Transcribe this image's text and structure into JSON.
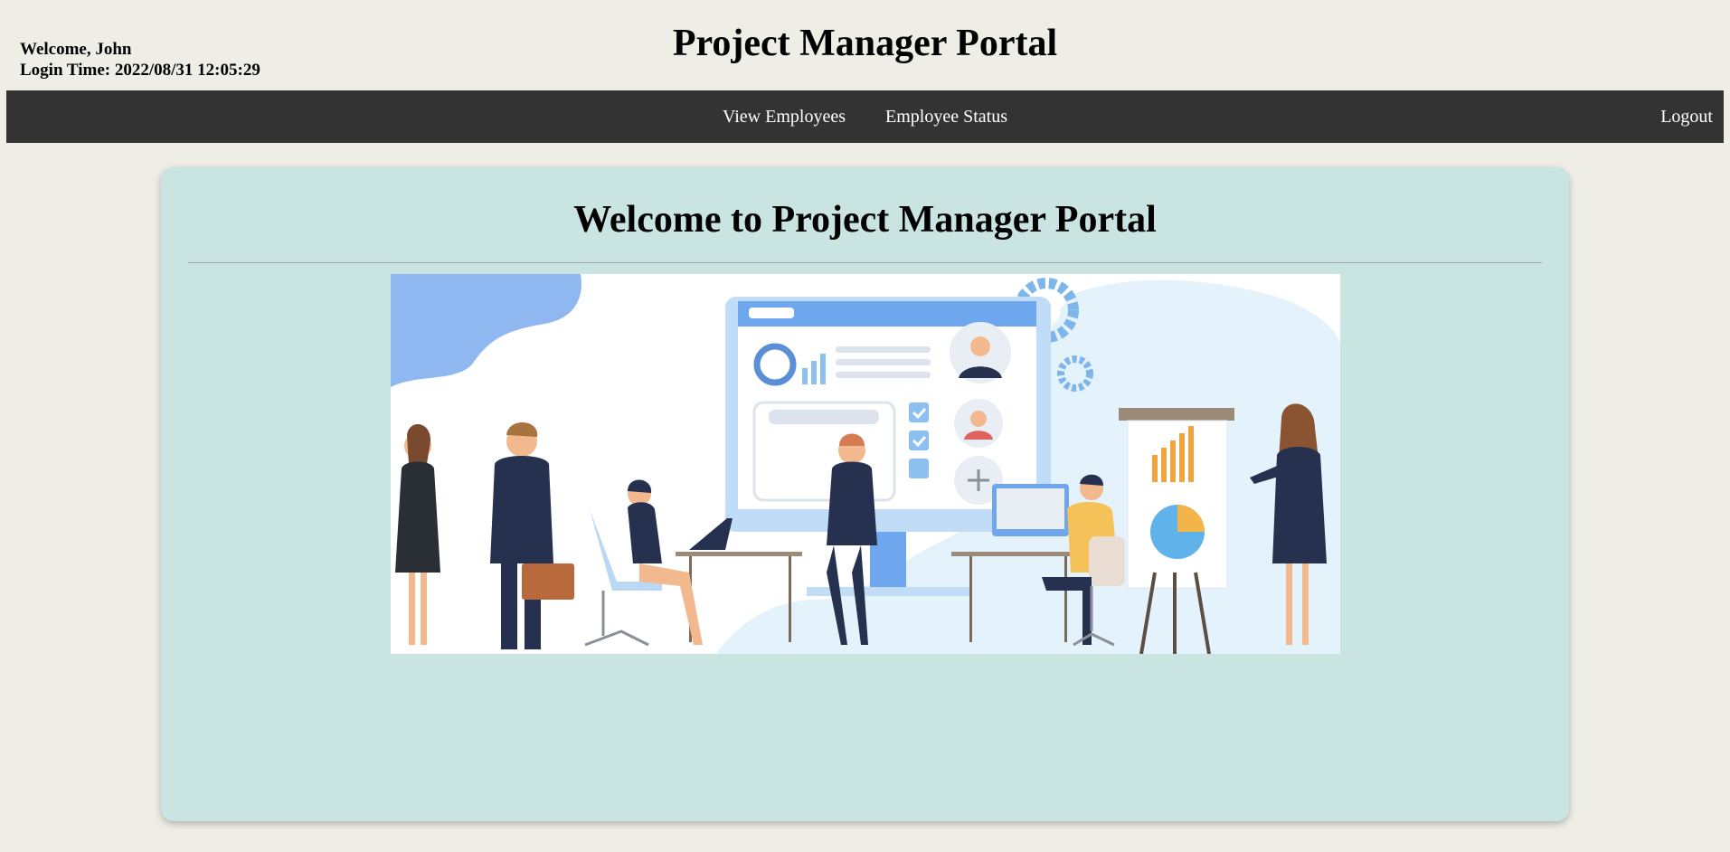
{
  "header": {
    "welcome": "Welcome, John",
    "login_time": "Login Time: 2022/08/31 12:05:29",
    "title": "Project Manager Portal"
  },
  "nav": {
    "items": [
      {
        "label": "View Employees"
      },
      {
        "label": "Employee Status"
      }
    ],
    "logout": "Logout"
  },
  "main": {
    "heading": "Welcome to Project Manager Portal",
    "hero_icon": "office-team-illustration"
  },
  "colors": {
    "page_bg": "#eeede6",
    "navbar": "#333333",
    "card_bg": "#cae4e1",
    "nav_text": "#ffffff"
  }
}
